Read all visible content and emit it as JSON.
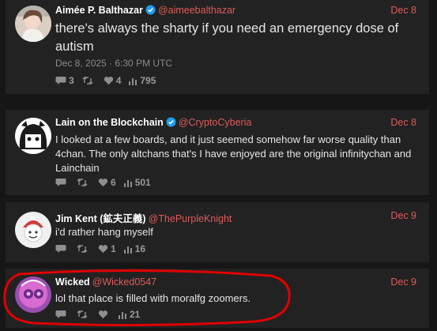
{
  "posts": [
    {
      "name": "Aimée P. Balthazar",
      "verified": true,
      "handle": "@aimeebalthazar",
      "date": "Dec 8",
      "text": "there's always the sharty if you need an emergency dose of autism",
      "timestamp": "Dec 8, 2025 · 6:30 PM UTC",
      "replies": "3",
      "reposts": "",
      "likes": "4",
      "views": "795"
    },
    {
      "name": "Lain on the Blockchain",
      "verified": true,
      "handle": "@CryptoCyberia",
      "date": "Dec 8",
      "text": "I looked at a few boards, and it just seemed somehow far worse quality than 4chan. The only altchans that's I have enjoyed are the original infinitychan and Lainchain",
      "replies": "",
      "reposts": "",
      "likes": "6",
      "views": "501"
    },
    {
      "name": "Jim Kent (鉱夫正義)",
      "verified": false,
      "handle": "@ThePurpleKnight",
      "date": "Dec 9",
      "text": "i'd rather hang myself",
      "replies": "",
      "reposts": "",
      "likes": "1",
      "views": "16"
    },
    {
      "name": "Wicked",
      "verified": false,
      "handle": "@Wicked0547",
      "date": "Dec 9",
      "text": "lol that place is filled with moralfg zoomers.",
      "replies": "",
      "reposts": "",
      "likes": "",
      "views": "21"
    }
  ],
  "colors": {
    "background": "#161616",
    "card": "#222222",
    "accent": "#e05a5a",
    "verified": "#1d9bf0",
    "annotation": "#e00000"
  },
  "icons": [
    "reply-icon",
    "repost-icon",
    "like-icon",
    "views-icon",
    "verified-badge-icon"
  ]
}
